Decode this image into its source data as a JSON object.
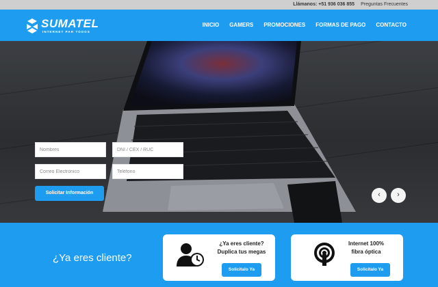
{
  "topbar": {
    "phone": "Llámanos: +51 936 036 855",
    "faq": "Preguntas Frecuentes"
  },
  "brand": {
    "name": "SUMATEL",
    "tagline": "INTERNET PAR TODOS",
    "logo_icon": "s-arrows-logo-icon"
  },
  "nav": {
    "items": [
      "INICIO",
      "GAMERS",
      "PROMOCIONES",
      "FORMAS DE PAGO",
      "CONTACTO"
    ]
  },
  "form": {
    "nombres_placeholder": "Nombres",
    "dni_placeholder": "DNI / CEX / RUC",
    "correo_placeholder": "Correo Electrónico",
    "telefono_placeholder": "Teléfono",
    "submit_label": "Solicitar Información"
  },
  "carousel": {
    "prev": "‹",
    "next": "›"
  },
  "client_section": {
    "title": "¿Ya eres cliente?"
  },
  "cards": [
    {
      "line1": "¿Ya eres cliente?",
      "line2": "Duplica tus megas",
      "button": "Solicitalo Ya",
      "icon": "user-clock-icon"
    },
    {
      "line1": "Internet 100%",
      "line2": "fibra óptica",
      "button": "Solicitalo Ya",
      "icon": "broadcast-icon"
    }
  ],
  "colors": {
    "primary": "#1e9cf0",
    "topbar": "#cfcfcf",
    "hero_dark": "#2b2d30"
  }
}
